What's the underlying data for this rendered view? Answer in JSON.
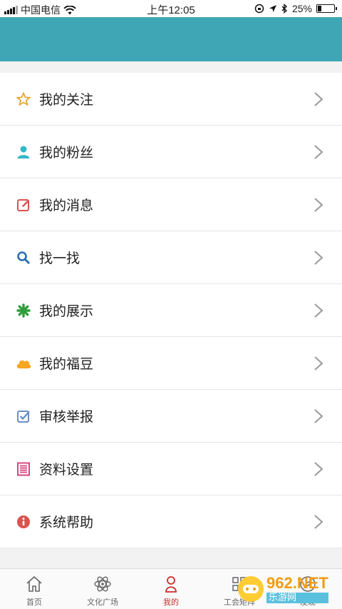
{
  "status_bar": {
    "carrier": "中国电信",
    "time": "上午12:05",
    "battery_percent": "25%",
    "battery_level": 0.25
  },
  "menu": {
    "items": [
      {
        "label": "我的关注",
        "icon": "star-icon",
        "color": "#e5a020"
      },
      {
        "label": "我的粉丝",
        "icon": "person-icon",
        "color": "#36b6c9"
      },
      {
        "label": "我的消息",
        "icon": "edit-icon",
        "color": "#d9534f"
      },
      {
        "label": "找一找",
        "icon": "search-icon",
        "color": "#2a6fb0"
      },
      {
        "label": "我的展示",
        "icon": "flower-icon",
        "color": "#2e9e3a"
      },
      {
        "label": "我的福豆",
        "icon": "cloud-icon",
        "color": "#f5a623"
      },
      {
        "label": "审核举报",
        "icon": "checkbox-icon",
        "color": "#6b8fc9"
      },
      {
        "label": "资料设置",
        "icon": "list-icon",
        "color": "#d6477d"
      },
      {
        "label": "系统帮助",
        "icon": "info-icon",
        "color": "#d9534f"
      }
    ]
  },
  "tabbar": {
    "tabs": [
      {
        "label": "首页",
        "icon": "home-icon"
      },
      {
        "label": "文化广场",
        "icon": "atom-icon"
      },
      {
        "label": "我的",
        "icon": "user-icon"
      },
      {
        "label": "工会矩阵",
        "icon": "matrix-icon"
      },
      {
        "label": "发现",
        "icon": "discover-icon"
      }
    ],
    "active_color": "#c9302c"
  },
  "header": {
    "color": "#3ea6b4"
  },
  "watermark": {
    "top": "962.NET",
    "bottom": "乐游网"
  }
}
